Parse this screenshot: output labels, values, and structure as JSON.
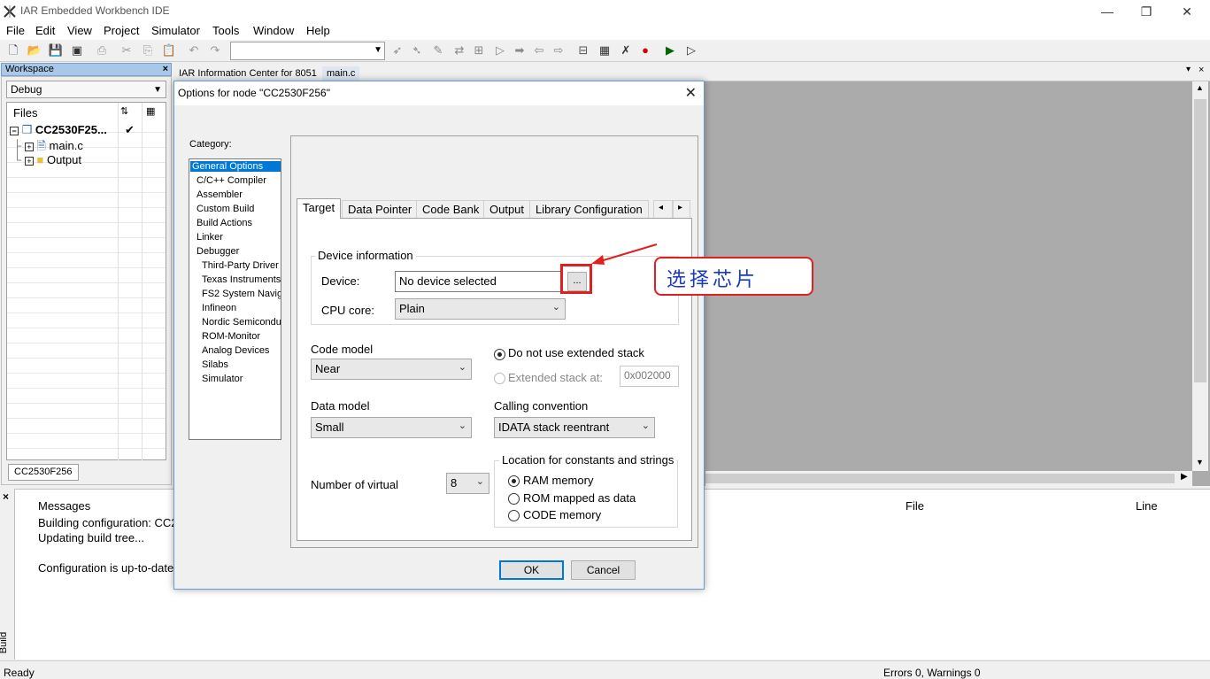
{
  "titlebar": {
    "title": "IAR Embedded Workbench IDE",
    "minimize": "—",
    "restore": "❐",
    "close": "✕"
  },
  "menu": [
    "File",
    "Edit",
    "View",
    "Project",
    "Simulator",
    "Tools",
    "Window",
    "Help"
  ],
  "workspace": {
    "header": "Workspace",
    "close": "×",
    "config": "Debug",
    "files_label": "Files",
    "project": "CC2530F25...",
    "project_check": "✔",
    "items": [
      "main.c",
      "Output"
    ],
    "tab": "CC2530F256"
  },
  "editor": {
    "tabs": [
      "IAR Information Center for 8051",
      "main.c"
    ]
  },
  "messages": {
    "col_messages": "Messages",
    "col_file": "File",
    "col_line": "Line",
    "lines": [
      "Building configuration: CC2",
      "Updating build tree...",
      "",
      "Configuration is up-to-date"
    ],
    "side_tab": "Build",
    "close": "×"
  },
  "status": {
    "left": "Ready",
    "right": "Errors 0, Warnings 0"
  },
  "dialog": {
    "title": "Options for node \"CC2530F256\"",
    "close": "✕",
    "category_label": "Category:",
    "categories": [
      "General Options",
      "C/C++ Compiler",
      "Assembler",
      "Custom Build",
      "Build Actions",
      "Linker",
      "Debugger",
      "Third-Party Driver",
      "Texas Instruments",
      "FS2 System Navig",
      "Infineon",
      "Nordic Semiconduc",
      "ROM-Monitor",
      "Analog Devices",
      "Silabs",
      "Simulator"
    ],
    "tabs": [
      "Target",
      "Data Pointer",
      "Code Bank",
      "Output",
      "Library Configuration"
    ],
    "tab_scroll_left": "◂",
    "tab_scroll_right": "▸",
    "device_info": {
      "group": "Device information",
      "device_label": "Device:",
      "device_value": "No device selected",
      "browse": "...",
      "cpu_label": "CPU core:",
      "cpu_value": "Plain"
    },
    "code_model": {
      "label": "Code model",
      "value": "Near"
    },
    "stack": {
      "option1": "Do not use extended stack",
      "option2": "Extended stack at:",
      "address": "0x002000"
    },
    "data_model": {
      "label": "Data model",
      "value": "Small"
    },
    "calling": {
      "label": "Calling convention",
      "value": "IDATA stack reentrant"
    },
    "virtual": {
      "label": "Number of virtual",
      "value": "8"
    },
    "location": {
      "group": "Location for constants and strings",
      "opt1": "RAM memory",
      "opt2": "ROM mapped as data",
      "opt3": "CODE memory"
    },
    "ok": "OK",
    "cancel": "Cancel"
  },
  "annotation": {
    "text": "选择芯片"
  },
  "colors": {
    "accent": "#0078d7",
    "annotation_red": "#e02020",
    "annotation_text": "#1a3ac0"
  }
}
